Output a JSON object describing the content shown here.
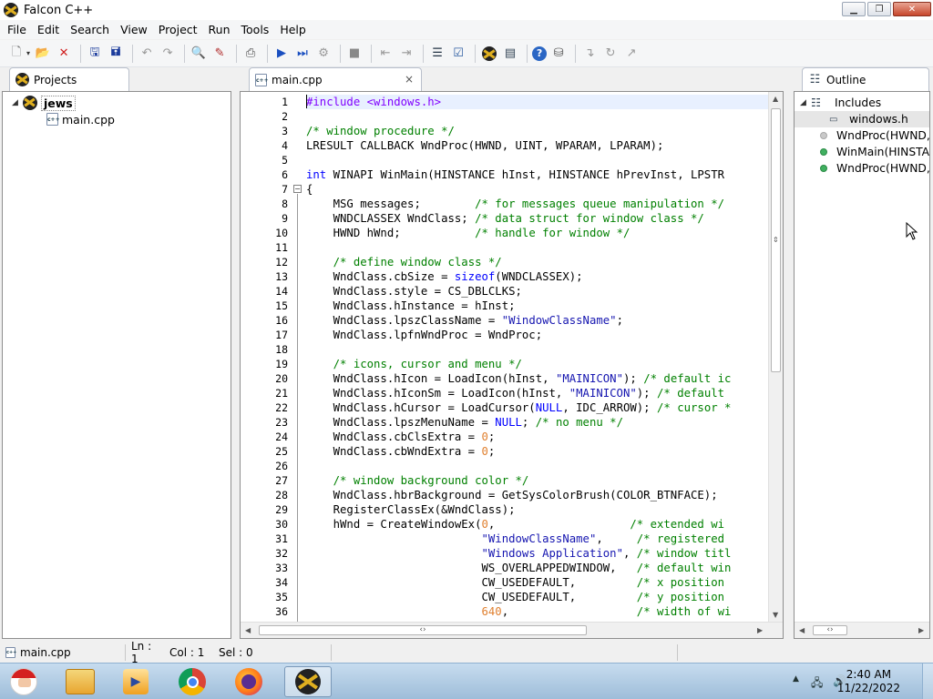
{
  "window": {
    "title": "Falcon C++"
  },
  "menu": [
    "File",
    "Edit",
    "Search",
    "View",
    "Project",
    "Run",
    "Tools",
    "Help"
  ],
  "toolbar_icons": [
    "new-file-icon",
    "open-folder-icon",
    "close-file-icon",
    "save-icon",
    "save-all-icon",
    "undo-icon",
    "redo-icon",
    "find-icon",
    "replace-icon",
    "print-icon",
    "run-icon",
    "compile-run-icon",
    "build-icon",
    "stop-icon",
    "step-back-icon",
    "step-forward-icon",
    "list-icon",
    "todo-icon",
    "project-icon",
    "properties-icon",
    "help-icon",
    "package-icon",
    "step-into-icon",
    "step-over-icon",
    "step-out-icon"
  ],
  "projects_panel": {
    "tab_label": "Projects",
    "project_name": "jews",
    "files": [
      "main.cpp"
    ]
  },
  "editor": {
    "tab_label": "main.cpp",
    "close_glyph": "×",
    "line_numbers": [
      "1",
      "2",
      "3",
      "4",
      "5",
      "6",
      "7",
      "8",
      "9",
      "10",
      "11",
      "12",
      "13",
      "14",
      "15",
      "16",
      "17",
      "18",
      "19",
      "20",
      "21",
      "22",
      "23",
      "24",
      "25",
      "26",
      "27",
      "28",
      "29",
      "30",
      "31",
      "32",
      "33",
      "34",
      "35",
      "36"
    ],
    "code": [
      "#include <windows.h>",
      "",
      "/* window procedure */",
      "LRESULT CALLBACK WndProc(HWND, UINT, WPARAM, LPARAM);",
      "",
      "int WINAPI WinMain(HINSTANCE hInst, HINSTANCE hPrevInst, LPSTR",
      "{",
      "    MSG messages;        /* for messages queue manipulation */",
      "    WNDCLASSEX WndClass; /* data struct for window class */",
      "    HWND hWnd;           /* handle for window */",
      "",
      "    /* define window class */",
      "    WndClass.cbSize = sizeof(WNDCLASSEX);",
      "    WndClass.style = CS_DBLCLKS;",
      "    WndClass.hInstance = hInst;",
      "    WndClass.lpszClassName = \"WindowClassName\";",
      "    WndClass.lpfnWndProc = WndProc;",
      "",
      "    /* icons, cursor and menu */",
      "    WndClass.hIcon = LoadIcon(hInst, \"MAINICON\"); /* default ic",
      "    WndClass.hIconSm = LoadIcon(hInst, \"MAINICON\"); /* default",
      "    WndClass.hCursor = LoadCursor(NULL, IDC_ARROW); /* cursor *",
      "    WndClass.lpszMenuName = NULL; /* no menu */",
      "    WndClass.cbClsExtra = 0;",
      "    WndClass.cbWndExtra = 0;",
      "",
      "    /* window background color */",
      "    WndClass.hbrBackground = GetSysColorBrush(COLOR_BTNFACE);",
      "    RegisterClassEx(&WndClass);",
      "    hWnd = CreateWindowEx(0,                    /* extended wi",
      "                          \"WindowClassName\",     /* registered",
      "                          \"Windows Application\", /* window titl",
      "                          WS_OVERLAPPEDWINDOW,   /* default win",
      "                          CW_USEDEFAULT,         /* x position",
      "                          CW_USEDEFAULT,         /* y position",
      "                          640,                   /* width of wi"
    ]
  },
  "outline_panel": {
    "tab_label": "Outline",
    "items": [
      {
        "label": "Includes",
        "kind": "group"
      },
      {
        "label": "windows.h",
        "kind": "include"
      },
      {
        "label": "WndProc(HWND,",
        "kind": "prototype"
      },
      {
        "label": "WinMain(HINSTAI",
        "kind": "function"
      },
      {
        "label": "WndProc(HWND,",
        "kind": "function"
      }
    ]
  },
  "statusbar": {
    "file": "main.cpp",
    "line": "Ln : 1",
    "col": "Col : 1",
    "sel": "Sel : 0"
  },
  "taskbar": {
    "time": "2:40 AM",
    "date": "11/22/2022",
    "apps": [
      "santa-icon",
      "file-explorer-icon",
      "media-player-icon",
      "chrome-icon",
      "firefox-icon",
      "falcon-cpp-icon"
    ]
  },
  "colors": {
    "keyword": "#0000ff",
    "preprocessor": "#8000ff",
    "string": "#1515b0",
    "comment": "#008000",
    "number": "#e08030"
  }
}
